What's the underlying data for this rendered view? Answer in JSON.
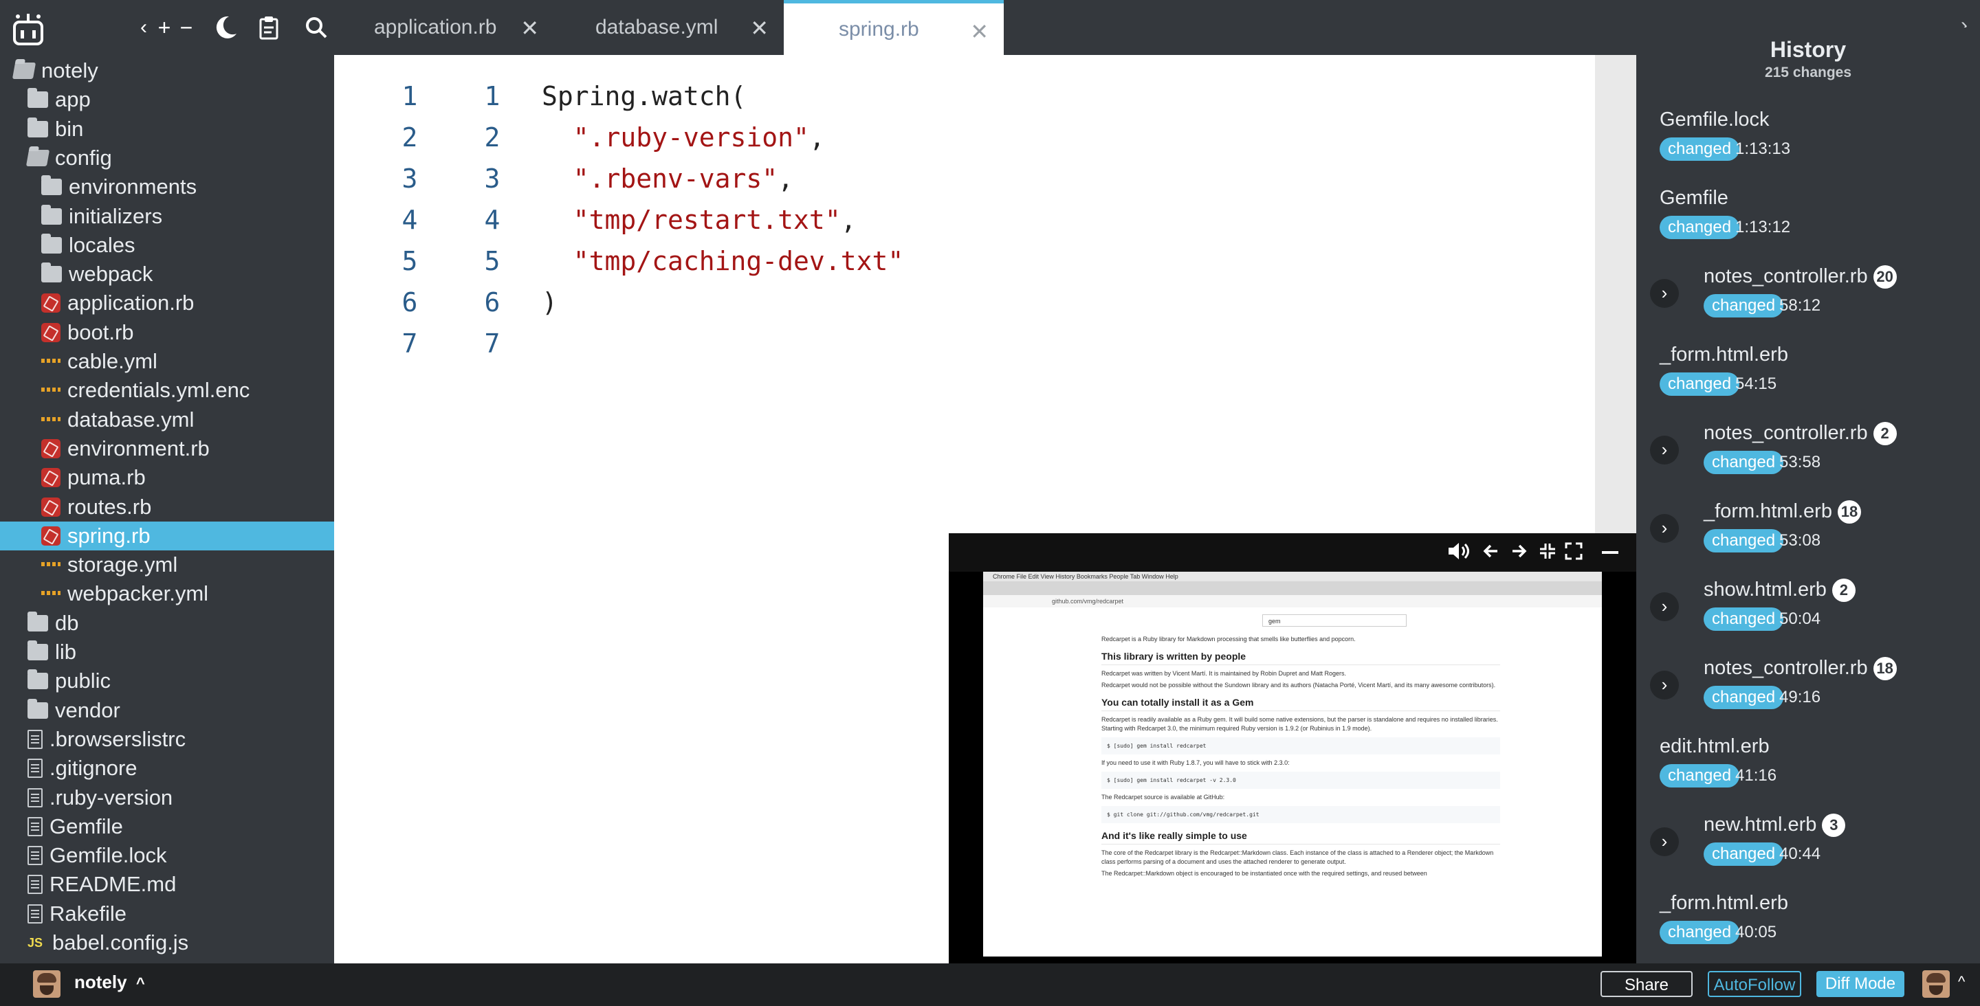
{
  "toolbar": {
    "logo_icon": "robot-logo-icon",
    "nav_icons": [
      "chevron-left-icon",
      "plus-icon",
      "minus-icon",
      "moon-icon",
      "clipboard-icon",
      "search-icon"
    ]
  },
  "tabs": [
    {
      "label": "application.rb",
      "active": false
    },
    {
      "label": "database.yml",
      "active": false
    },
    {
      "label": "spring.rb",
      "active": true
    }
  ],
  "sidebar": {
    "items": [
      {
        "label": "notely",
        "type": "folder-open",
        "depth": 0
      },
      {
        "label": "app",
        "type": "folder",
        "depth": 1
      },
      {
        "label": "bin",
        "type": "folder",
        "depth": 1
      },
      {
        "label": "config",
        "type": "folder-open",
        "depth": 1
      },
      {
        "label": "environments",
        "type": "folder",
        "depth": 2
      },
      {
        "label": "initializers",
        "type": "folder",
        "depth": 2
      },
      {
        "label": "locales",
        "type": "folder",
        "depth": 2
      },
      {
        "label": "webpack",
        "type": "folder",
        "depth": 2
      },
      {
        "label": "application.rb",
        "type": "ruby",
        "depth": 2
      },
      {
        "label": "boot.rb",
        "type": "ruby",
        "depth": 2
      },
      {
        "label": "cable.yml",
        "type": "yml",
        "depth": 2
      },
      {
        "label": "credentials.yml.enc",
        "type": "yml",
        "depth": 2
      },
      {
        "label": "database.yml",
        "type": "yml",
        "depth": 2
      },
      {
        "label": "environment.rb",
        "type": "ruby",
        "depth": 2
      },
      {
        "label": "puma.rb",
        "type": "ruby",
        "depth": 2
      },
      {
        "label": "routes.rb",
        "type": "ruby",
        "depth": 2
      },
      {
        "label": "spring.rb",
        "type": "ruby",
        "depth": 2,
        "selected": true
      },
      {
        "label": "storage.yml",
        "type": "yml",
        "depth": 2
      },
      {
        "label": "webpacker.yml",
        "type": "yml",
        "depth": 2
      },
      {
        "label": "db",
        "type": "folder",
        "depth": 1
      },
      {
        "label": "lib",
        "type": "folder",
        "depth": 1
      },
      {
        "label": "public",
        "type": "folder",
        "depth": 1
      },
      {
        "label": "vendor",
        "type": "folder",
        "depth": 1
      },
      {
        "label": ".browserslistrc",
        "type": "file",
        "depth": 1
      },
      {
        "label": ".gitignore",
        "type": "file",
        "depth": 1
      },
      {
        "label": ".ruby-version",
        "type": "file",
        "depth": 1
      },
      {
        "label": "Gemfile",
        "type": "file",
        "depth": 1
      },
      {
        "label": "Gemfile.lock",
        "type": "file",
        "depth": 1
      },
      {
        "label": "README.md",
        "type": "file",
        "depth": 1
      },
      {
        "label": "Rakefile",
        "type": "file",
        "depth": 1
      },
      {
        "label": "babel.config.js",
        "type": "js",
        "depth": 1
      }
    ]
  },
  "editor": {
    "lines": [
      {
        "left": "1",
        "right": "1",
        "code": [
          {
            "t": "Spring.watch(",
            "c": "plain"
          }
        ]
      },
      {
        "left": "2",
        "right": "2",
        "code": [
          {
            "t": "  ",
            "c": "plain"
          },
          {
            "t": "\".ruby-version\"",
            "c": "str"
          },
          {
            "t": ",",
            "c": "plain"
          }
        ]
      },
      {
        "left": "3",
        "right": "3",
        "code": [
          {
            "t": "  ",
            "c": "plain"
          },
          {
            "t": "\".rbenv-vars\"",
            "c": "str"
          },
          {
            "t": ",",
            "c": "plain"
          }
        ]
      },
      {
        "left": "4",
        "right": "4",
        "code": [
          {
            "t": "  ",
            "c": "plain"
          },
          {
            "t": "\"tmp/restart.txt\"",
            "c": "str"
          },
          {
            "t": ",",
            "c": "plain"
          }
        ]
      },
      {
        "left": "5",
        "right": "5",
        "code": [
          {
            "t": "  ",
            "c": "plain"
          },
          {
            "t": "\"tmp/caching-dev.txt\"",
            "c": "str"
          }
        ]
      },
      {
        "left": "6",
        "right": "6",
        "code": [
          {
            "t": ")",
            "c": "plain"
          }
        ]
      },
      {
        "left": "7",
        "right": "7",
        "code": []
      }
    ]
  },
  "history": {
    "title": "History",
    "count": "215 changes",
    "changed_label": "changed",
    "items": [
      {
        "name": "Gemfile.lock",
        "time": "1:13:13",
        "badge": "",
        "expandable": false
      },
      {
        "name": "Gemfile",
        "time": "1:13:12",
        "badge": "",
        "expandable": false
      },
      {
        "name": "notes_controller.rb",
        "time": "58:12",
        "badge": "20",
        "expandable": true
      },
      {
        "name": "_form.html.erb",
        "time": "54:15",
        "badge": "",
        "expandable": false
      },
      {
        "name": "notes_controller.rb",
        "time": "53:58",
        "badge": "2",
        "expandable": true
      },
      {
        "name": "_form.html.erb",
        "time": "53:08",
        "badge": "18",
        "expandable": true
      },
      {
        "name": "show.html.erb",
        "time": "50:04",
        "badge": "2",
        "expandable": true
      },
      {
        "name": "notes_controller.rb",
        "time": "49:16",
        "badge": "18",
        "expandable": true
      },
      {
        "name": "edit.html.erb",
        "time": "41:16",
        "badge": "",
        "expandable": false
      },
      {
        "name": "new.html.erb",
        "time": "40:44",
        "badge": "3",
        "expandable": true
      },
      {
        "name": "_form.html.erb",
        "time": "40:05",
        "badge": "",
        "expandable": false
      }
    ]
  },
  "video": {
    "controls": [
      "volume-icon",
      "arrow-left-icon",
      "arrow-right-icon",
      "shrink-icon",
      "fullscreen-icon",
      "minimize-icon"
    ],
    "screen": {
      "menubar": "Chrome   File   Edit   View   History   Bookmarks   People   Tab   Window   Help",
      "url": "github.com/vmg/redcarpet",
      "search_value": "gem",
      "intro": "Redcarpet is a Ruby library for Markdown processing that smells like butterflies and popcorn.",
      "h1": "This library is written by people",
      "p1": "Redcarpet was written by Vicent Martí. It is maintained by Robin Dupret and Matt Rogers.",
      "p2": "Redcarpet would not be possible without the Sundown library and its authors (Natacha Porté, Vicent Martí, and its many awesome contributors).",
      "h2": "You can totally install it as a Gem",
      "p3": "Redcarpet is readily available as a Ruby gem. It will build some native extensions, but the parser is standalone and requires no installed libraries. Starting with Redcarpet 3.0, the minimum required Ruby version is 1.9.2 (or Rubinius in 1.9 mode).",
      "code1": "$ [sudo] gem install redcarpet",
      "p4": "If you need to use it with Ruby 1.8.7, you will have to stick with 2.3.0:",
      "code2": "$ [sudo] gem install redcarpet -v 2.3.0",
      "p5": "The Redcarpet source is available at GitHub:",
      "code3": "$ git clone git://github.com/vmg/redcarpet.git",
      "h3": "And it's like really simple to use",
      "p6": "The core of the Redcarpet library is the Redcarpet::Markdown class. Each instance of the class is attached to a Renderer object; the Markdown class performs parsing of a document and uses the attached renderer to generate output.",
      "p7": "The Redcarpet::Markdown object is encouraged to be instantiated once with the required settings, and reused between"
    }
  },
  "statusbar": {
    "user": "notely",
    "share": "Share",
    "autofollow": "AutoFollow",
    "diffmode": "Diff Mode"
  },
  "colors": {
    "accent": "#4fb8e0",
    "panel": "#34383d",
    "string": "#a31515",
    "line_number": "#2a5c8a"
  }
}
